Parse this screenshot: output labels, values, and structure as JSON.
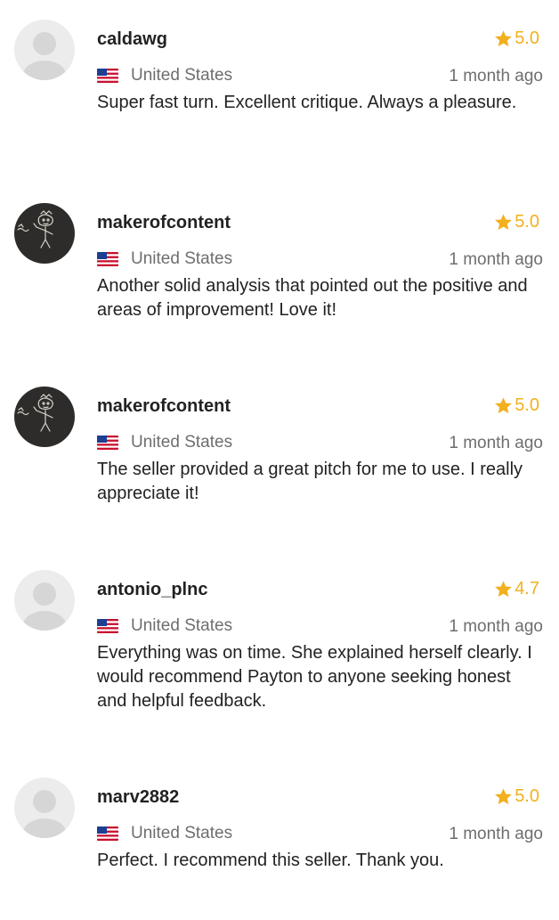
{
  "reviews": [
    {
      "username": "caldawg",
      "rating": "5.0",
      "country": "United States",
      "time": "1 month ago",
      "text": "Super fast turn. Excellent critique. Always a pleasure.",
      "avatar": "default"
    },
    {
      "username": "makerofcontent",
      "rating": "5.0",
      "country": "United States",
      "time": "1 month ago",
      "text": "Another solid analysis that pointed out the positive and areas of improvement!  Love it!",
      "avatar": "chalk-drawing"
    },
    {
      "username": "makerofcontent",
      "rating": "5.0",
      "country": "United States",
      "time": "1 month ago",
      "text": "The seller provided a great pitch for me to use.  I really appreciate it!",
      "avatar": "chalk-drawing"
    },
    {
      "username": "antonio_plnc",
      "rating": "4.7",
      "country": "United States",
      "time": "1 month ago",
      "text": "Everything was on time. She explained herself clearly. I would recommend Payton to anyone seeking honest and helpful feedback.",
      "avatar": "default"
    },
    {
      "username": "marv2882",
      "rating": "5.0",
      "country": "United States",
      "time": "1 month ago",
      "text": "Perfect. I recommend this seller. Thank you.",
      "avatar": "default"
    }
  ],
  "colors": {
    "star": "#f2b01e",
    "meta_text": "#6e6e6e",
    "body_text": "#222222",
    "avatar_default_bg": "#ececec",
    "avatar_default_fg": "#d6d6d6",
    "avatar_chalk_bg": "#2e2c2a"
  },
  "icons": [
    "star-icon",
    "us-flag-icon",
    "default-avatar-icon",
    "chalk-avatar-icon"
  ]
}
